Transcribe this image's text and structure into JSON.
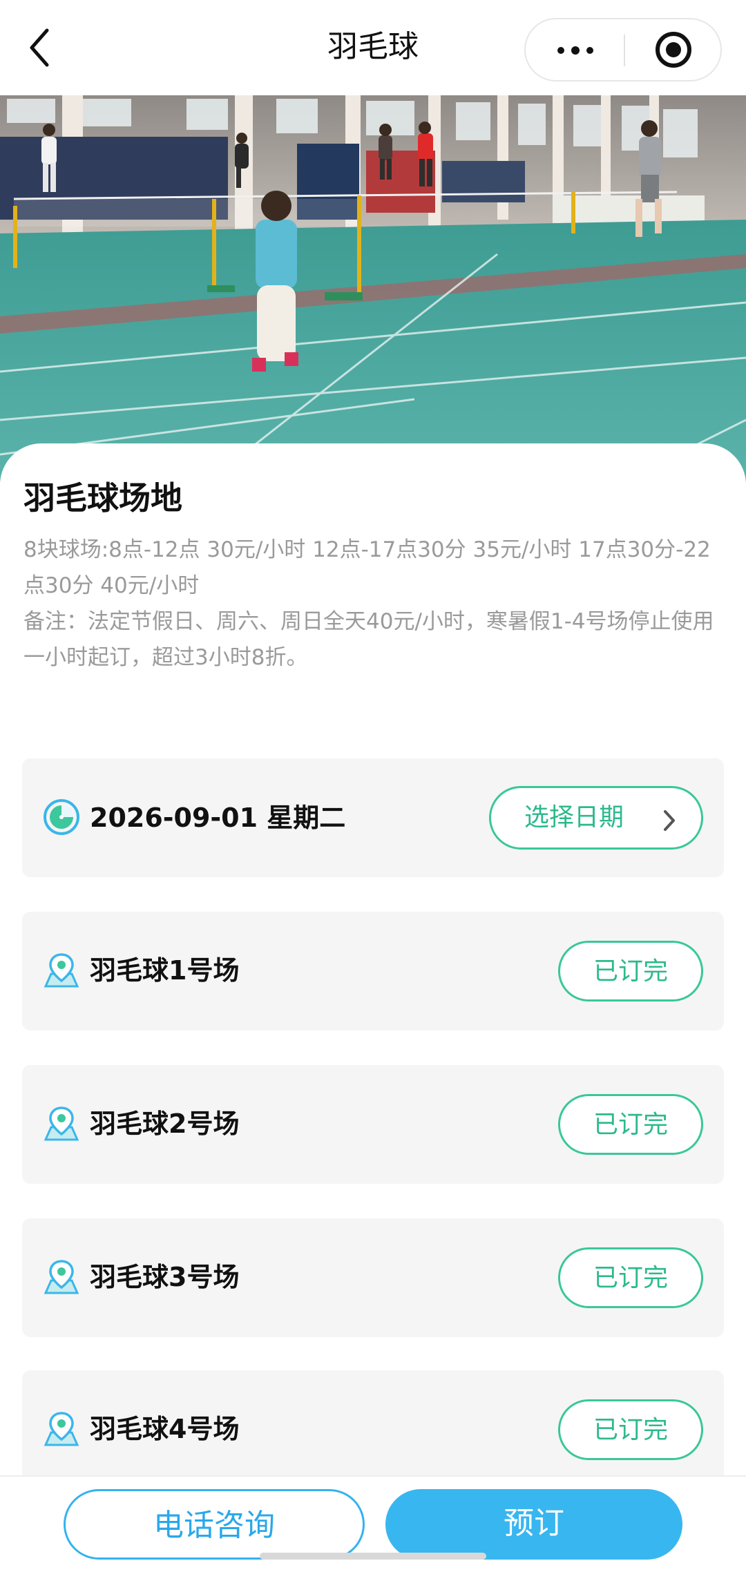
{
  "navbar": {
    "title": "羽毛球",
    "back_icon": "chevron-left-icon",
    "more_icon": "more-dots-icon",
    "close_icon": "target-circle-icon"
  },
  "hero": {
    "image": "badminton-hall-photo"
  },
  "venue": {
    "title": "羽毛球场地",
    "description_lines": [
      "8块球场:8点-12点 30元/小时 12点-17点30分 35元/小时 17点30分-22点30分 40元/小时",
      "备注：法定节假日、周六、周日全天40元/小时，寒暑假1-4号场停止使用",
      "一小时起订，超过3小时8折。"
    ]
  },
  "date_row": {
    "icon": "clock-icon",
    "date": "2026-09-01 星期二",
    "button_label": "选择日期",
    "button_icon": "chevron-right-icon"
  },
  "courts": [
    {
      "name": "羽毛球1号场",
      "status": "已订完",
      "icon": "location-pin-icon"
    },
    {
      "name": "羽毛球2号场",
      "status": "已订完",
      "icon": "location-pin-icon"
    },
    {
      "name": "羽毛球3号场",
      "status": "已订完",
      "icon": "location-pin-icon"
    },
    {
      "name": "羽毛球4号场",
      "status": "已订完",
      "icon": "location-pin-icon"
    }
  ],
  "bottom_bar": {
    "phone_label": "电话咨询",
    "book_label": "预订"
  },
  "colors": {
    "accent_green": "#39c79a",
    "accent_blue": "#38b6f0",
    "card_bg": "#f5f5f5",
    "muted_text": "#9a9a9a"
  }
}
